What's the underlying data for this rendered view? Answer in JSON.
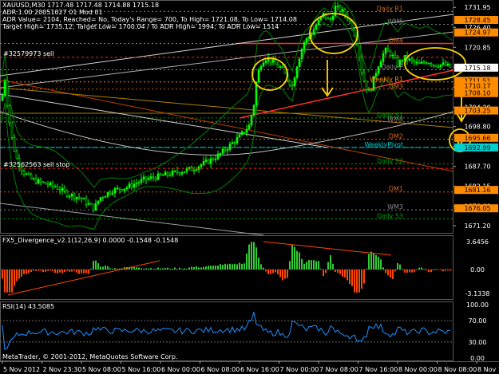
{
  "window": {
    "header_lines": [
      "XAUUSD,M30  1717.48 1717.48 1714.88 1715.18",
      "ADR:1.00  20051027 01 Mod 01",
      "ADR Value= 2104, Reached= No, Today's Range= 700, To High= 1721.08, To Low= 1714.08",
      "Target High= 1735.12; Target Low= 1700.04 / To ADR High= 1994; To ADR Low= 1514"
    ],
    "footer": "MetaTrader, © 2001-2012, MetaQuotes Software Corp."
  },
  "main_chart": {
    "symbol": "XAUUSD",
    "timeframe": "M30",
    "price_min": 1669.0,
    "price_max": 1734.0,
    "price_ticks": [
      "1731.95",
      "1726.40",
      "1720.85",
      "1715.30",
      "1709.75",
      "1704.20",
      "1698.80",
      "1693.25",
      "1687.70",
      "1682.15",
      "1676.60",
      "1671.20"
    ],
    "price_tick_values": [
      1731.95,
      1726.4,
      1720.85,
      1715.3,
      1709.75,
      1704.2,
      1698.8,
      1693.25,
      1687.7,
      1682.15,
      1676.6,
      1671.2
    ],
    "price_tags": [
      {
        "label": "1728.45",
        "value": 1728.45,
        "color": "#ff8c00"
      },
      {
        "label": "1724.97",
        "value": 1724.97,
        "color": "#ff8c00"
      },
      {
        "label": "1715.18",
        "value": 1715.18,
        "color": "#ffffff",
        "text": "#000000"
      },
      {
        "label": "1711.51",
        "value": 1711.51,
        "color": "#ff8c00"
      },
      {
        "label": "1710.17",
        "value": 1710.17,
        "color": "#ff8c00"
      },
      {
        "label": "1708.10",
        "value": 1708.1,
        "color": "#ff8c00"
      },
      {
        "label": "1703.25",
        "value": 1703.25,
        "color": "#ff8c00"
      },
      {
        "label": "1695.66",
        "value": 1695.66,
        "color": "#ff8c00"
      },
      {
        "label": "1692.99",
        "value": 1692.99,
        "color": "#00cfcf"
      },
      {
        "label": "1681.16",
        "value": 1681.16,
        "color": "#ff8c00"
      },
      {
        "label": "1676.05",
        "value": 1676.05,
        "color": "#ff8c00"
      }
    ],
    "levels": [
      {
        "label": "Daily R1",
        "value": 1730.8,
        "color": "#d2691e"
      },
      {
        "label": "WM5",
        "value": 1727.2,
        "color": "#888888"
      },
      {
        "label": "DM4",
        "value": 1721.9,
        "color": "#d2691e"
      },
      {
        "label": "Daily P",
        "value": 1714.6,
        "color": "#888888"
      },
      {
        "label": "Weekly R1",
        "value": 1711.2,
        "color": "#ff8c00"
      },
      {
        "label": "DM3",
        "value": 1709.2,
        "color": "#d2691e"
      },
      {
        "label": "Daily S1",
        "value": 1701.2,
        "color": "#00a000"
      },
      {
        "label": "WM4",
        "value": 1700.1,
        "color": "#888888"
      },
      {
        "label": "DM2",
        "value": 1695.3,
        "color": "#d2691e"
      },
      {
        "label": "WeeklyPivot",
        "value": 1692.99,
        "color": "#00cfcf"
      },
      {
        "label": "Daily S2",
        "value": 1688.4,
        "color": "#00a000"
      },
      {
        "label": "DM1",
        "value": 1680.6,
        "color": "#d2691e"
      },
      {
        "label": "WM3",
        "value": 1675.6,
        "color": "#888888"
      },
      {
        "label": "Daily S3",
        "value": 1673.1,
        "color": "#00a000"
      }
    ],
    "order_labels": [
      {
        "label": "#32579973 sell",
        "value": 1718.5
      },
      {
        "label": "#32562563 sell stop",
        "value": 1687.6
      }
    ]
  },
  "fx5": {
    "title": "FX5_Divergence_v2.1(12,26,9) 0.0000 -0.1548 -0.1548",
    "ticks": [
      "3.6456",
      "0.00",
      "-3.1338"
    ],
    "tick_values": [
      3.6456,
      0.0,
      -3.1338
    ]
  },
  "rsi": {
    "title": "RSI(14) 43.5085",
    "ticks": [
      "100.00",
      "70.00",
      "30.00",
      "0.00"
    ],
    "tick_values": [
      100,
      70,
      30,
      0
    ]
  },
  "time_axis": [
    "5 Nov 2012",
    "2 Nov 23:30",
    "5 Nov 08:00",
    "5 Nov 16:00",
    "6 Nov 00:00",
    "6 Nov 08:00",
    "6 Nov 16:00",
    "7 Nov 00:00",
    "7 Nov 08:00",
    "7 Nov 16:00",
    "8 Nov 00:00",
    "8 Nov 08:00",
    "8 Nov 16:00"
  ]
}
